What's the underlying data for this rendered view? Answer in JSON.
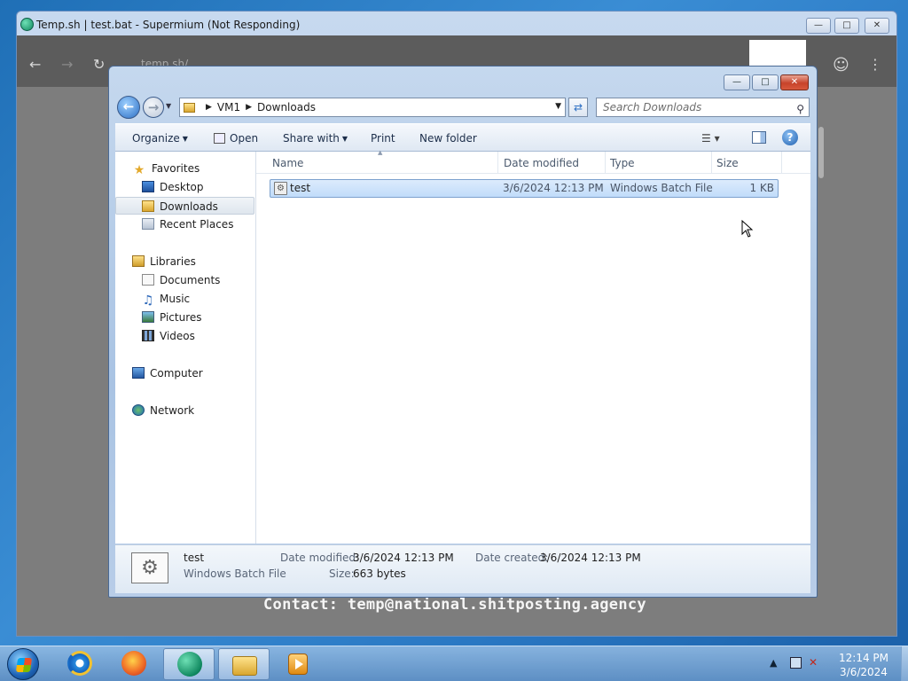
{
  "browser": {
    "title": "Temp.sh | test.bat - Supermium (Not Responding)",
    "url_fragment": "temp.sh/",
    "contact_text": "Contact: temp@national.shitposting.agency"
  },
  "explorer": {
    "breadcrumb": [
      "VM1",
      "Downloads"
    ],
    "search_placeholder": "Search Downloads",
    "commands": {
      "organize": "Organize",
      "open": "Open",
      "share_with": "Share with",
      "print": "Print",
      "new_folder": "New folder"
    },
    "nav": {
      "favorites": "Favorites",
      "desktop": "Desktop",
      "downloads": "Downloads",
      "recent_places": "Recent Places",
      "libraries": "Libraries",
      "documents": "Documents",
      "music": "Music",
      "pictures": "Pictures",
      "videos": "Videos",
      "computer": "Computer",
      "network": "Network"
    },
    "columns": {
      "name": "Name",
      "date_modified": "Date modified",
      "type": "Type",
      "size": "Size"
    },
    "files": [
      {
        "name": "test",
        "date_modified": "3/6/2024 12:13 PM",
        "type": "Windows Batch File",
        "size": "1 KB"
      }
    ],
    "details": {
      "name": "test",
      "type": "Windows Batch File",
      "date_modified_label": "Date modified:",
      "date_modified": "3/6/2024 12:13 PM",
      "date_created_label": "Date created:",
      "date_created": "3/6/2024 12:13 PM",
      "size_label": "Size:",
      "size": "663 bytes"
    }
  },
  "taskbar": {
    "time": "12:14 PM",
    "date": "3/6/2024"
  }
}
